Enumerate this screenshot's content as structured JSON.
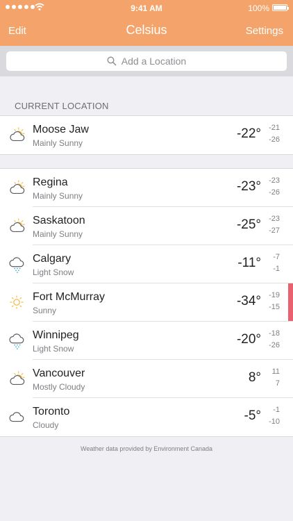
{
  "status_bar": {
    "time": "9:41 AM",
    "battery": "100%"
  },
  "nav": {
    "edit_label": "Edit",
    "title": "Celsius",
    "settings_label": "Settings"
  },
  "search": {
    "placeholder": "Add a Location"
  },
  "current_location_header": "CURRENT LOCATION",
  "current_location": {
    "city": "Moose Jaw",
    "condition": "Mainly Sunny",
    "temp": "-22°",
    "high": "-21",
    "low": "-26",
    "icon": "partly-sunny-icon"
  },
  "locations": [
    {
      "city": "Regina",
      "condition": "Mainly Sunny",
      "temp": "-23°",
      "high": "-23",
      "low": "-26",
      "icon": "partly-sunny-icon"
    },
    {
      "city": "Saskatoon",
      "condition": "Mainly Sunny",
      "temp": "-25°",
      "high": "-23",
      "low": "-27",
      "icon": "partly-sunny-icon"
    },
    {
      "city": "Calgary",
      "condition": "Light Snow",
      "temp": "-11°",
      "high": "-7",
      "low": "-1",
      "icon": "snow-cloud-icon"
    },
    {
      "city": "Fort McMurray",
      "condition": "Sunny",
      "temp": "-34°",
      "high": "-19",
      "low": "-15",
      "icon": "sun-icon",
      "alert": true
    },
    {
      "city": "Winnipeg",
      "condition": "Light Snow",
      "temp": "-20°",
      "high": "-18",
      "low": "-26",
      "icon": "snow-cloud-icon"
    },
    {
      "city": "Vancouver",
      "condition": "Mostly Cloudy",
      "temp": "8°",
      "high": "11",
      "low": "7",
      "icon": "partly-sunny-icon"
    },
    {
      "city": "Toronto",
      "condition": "Cloudy",
      "temp": "-5°",
      "high": "-1",
      "low": "-10",
      "icon": "cloud-icon"
    }
  ],
  "footer": "Weather data provided by Environment Canada",
  "colors": {
    "accent": "#f4a46a",
    "alert": "#e9606e",
    "sun": "#f5b942"
  }
}
